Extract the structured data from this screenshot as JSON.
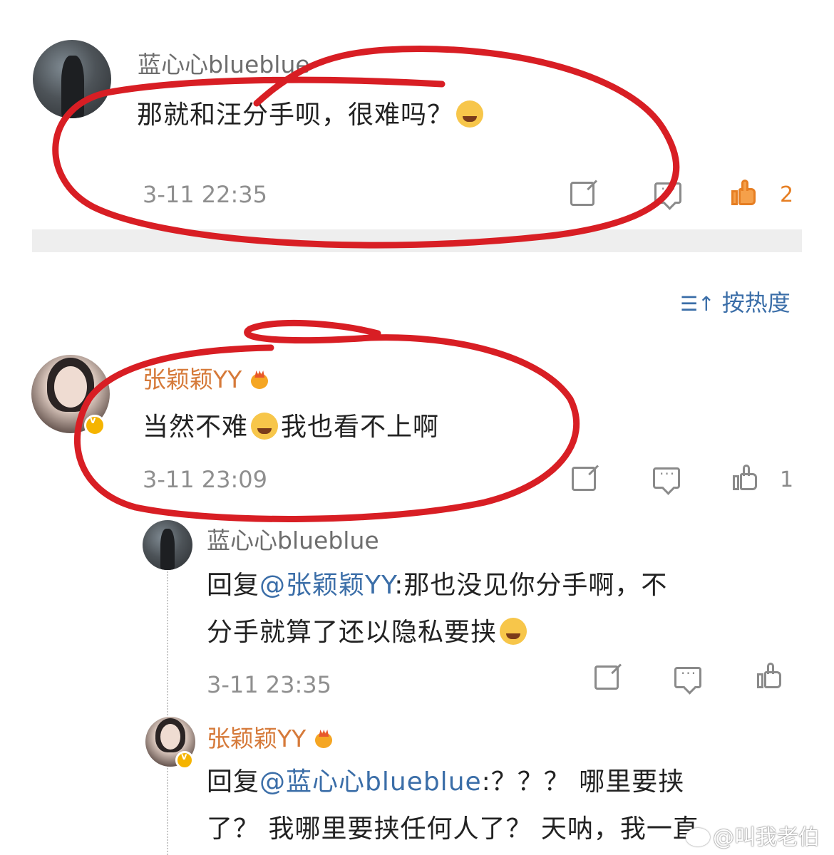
{
  "comment1": {
    "username": "蓝心心blueblue",
    "text": "那就和汪分手呗，很难吗？",
    "time": "3-11 22:35",
    "likes": "2"
  },
  "sort": {
    "label": "按热度"
  },
  "comment2": {
    "username": "张颖颖YY",
    "text_before": "当然不难",
    "text_after": "我也看不上啊",
    "time": "3-11 23:09",
    "likes": "1"
  },
  "reply1": {
    "username": "蓝心心blueblue",
    "prefix": "回复",
    "mention": "@张颖颖YY",
    "line1_rest": ":那也没见你分手啊，不",
    "line2": "分手就算了还以隐私要挟",
    "time": "3-11 23:35"
  },
  "reply2": {
    "username": "张颖颖YY",
    "prefix": "回复",
    "mention": "@蓝心心blueblue",
    "line1_rest": ":？？？ 哪里要挟",
    "line2": "了？ 我哪里要挟任何人了？ 天呐，我一直"
  },
  "watermark": {
    "text": "@叫我老伯"
  },
  "colors": {
    "username_orange": "#d67a3a",
    "mention_blue": "#3b6ea8",
    "annotation_red": "#d81e24",
    "like_active": "#e67e22"
  }
}
